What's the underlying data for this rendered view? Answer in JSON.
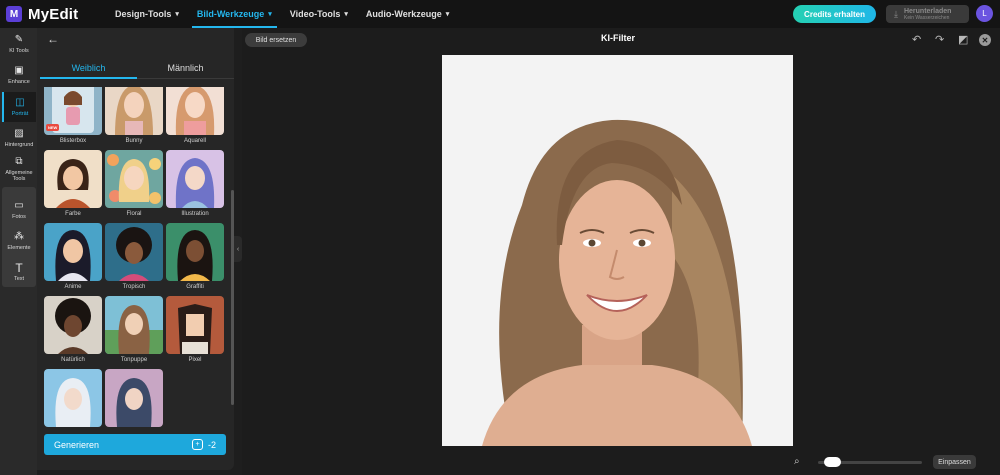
{
  "app": {
    "name": "MyEdit",
    "logo_letter": "M"
  },
  "nav": {
    "items": [
      {
        "label": "Design-Tools",
        "active": false
      },
      {
        "label": "Bild-Werkzeuge",
        "active": true
      },
      {
        "label": "Video-Tools",
        "active": false
      },
      {
        "label": "Audio-Werkzeuge",
        "active": false
      }
    ]
  },
  "header": {
    "credits_label": "Credits erhalten",
    "download_label": "Herunterladen",
    "download_sub": "Kein Wasserzeichen",
    "avatar_initial": "L"
  },
  "sidebar": {
    "items": [
      {
        "label": "KI Tools",
        "icon": "magic-wand-icon",
        "active": false
      },
      {
        "label": "Enhance",
        "icon": "enhance-icon",
        "active": false
      },
      {
        "label": "Porträt",
        "icon": "portrait-icon",
        "active": true
      },
      {
        "label": "Hintergrund",
        "icon": "background-icon",
        "active": false
      },
      {
        "label": "Allgemeine Tools",
        "icon": "tools-icon",
        "active": false
      },
      {
        "label": "Fotos",
        "icon": "photo-icon",
        "active": false
      },
      {
        "label": "Elemente",
        "icon": "elements-icon",
        "active": false
      },
      {
        "label": "Text",
        "icon": "text-icon",
        "active": false
      }
    ]
  },
  "panel": {
    "tabs": [
      {
        "label": "Weiblich",
        "active": true
      },
      {
        "label": "Männlich",
        "active": false
      }
    ],
    "styles": [
      {
        "label": "Blisterbox",
        "badge": "NEW"
      },
      {
        "label": "Bunny"
      },
      {
        "label": "Aquarell"
      },
      {
        "label": "Farbe"
      },
      {
        "label": "Floral"
      },
      {
        "label": "Illustration"
      },
      {
        "label": "Anime"
      },
      {
        "label": "Tropisch"
      },
      {
        "label": "Graffiti"
      },
      {
        "label": "Natürlich"
      },
      {
        "label": "Tonpuppe"
      },
      {
        "label": "Pixel"
      },
      {
        "label": ""
      },
      {
        "label": ""
      }
    ],
    "generate_label": "Generieren",
    "generate_cost": "-2"
  },
  "canvas": {
    "title": "KI-Filter",
    "replace_label": "Bild ersetzen",
    "fit_label": "Einpassen",
    "zoom_fraction": 0.08
  },
  "colors": {
    "accent": "#24b7ee",
    "brand": "#5b3fd6"
  }
}
